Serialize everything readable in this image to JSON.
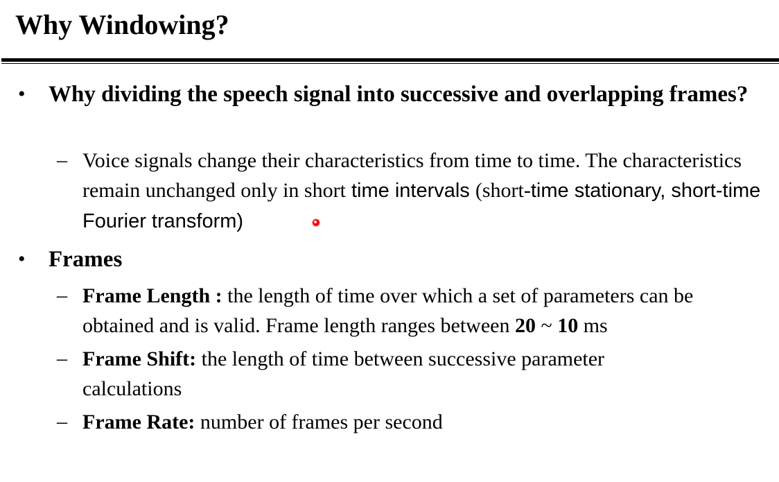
{
  "slide": {
    "title": "Why Windowing?",
    "bullets": [
      {
        "marker": "•",
        "heading": "Why dividing the speech signal into successive and overlapping frames?",
        "subitems": [
          {
            "marker": "–",
            "text_serif": "Voice signals change their characteristics from time to time. The characteristics remain unchanged only in short",
            "text_sans_a": " time intervals ",
            "text_serif_b": "(short-",
            "text_sans_c": "time stationary, short-time Fourier transform)"
          }
        ]
      },
      {
        "marker": "•",
        "heading": "Frames",
        "subitems": [
          {
            "marker": "–",
            "term": "Frame Length :",
            "desc": " the length of time over which a set of parameters can be obtained and is valid. Frame length ranges between ",
            "range_a": "20",
            "range_sep": " ~ ",
            "range_b": "10",
            "unit": " ms"
          },
          {
            "marker": "–",
            "term": "Frame Shift:",
            "desc": " the length of time between successive parameter calculations"
          },
          {
            "marker": "–",
            "term": "Frame Rate:",
            "desc": " number of frames per second"
          }
        ]
      }
    ]
  },
  "pointer": {
    "color": "#e00000"
  }
}
